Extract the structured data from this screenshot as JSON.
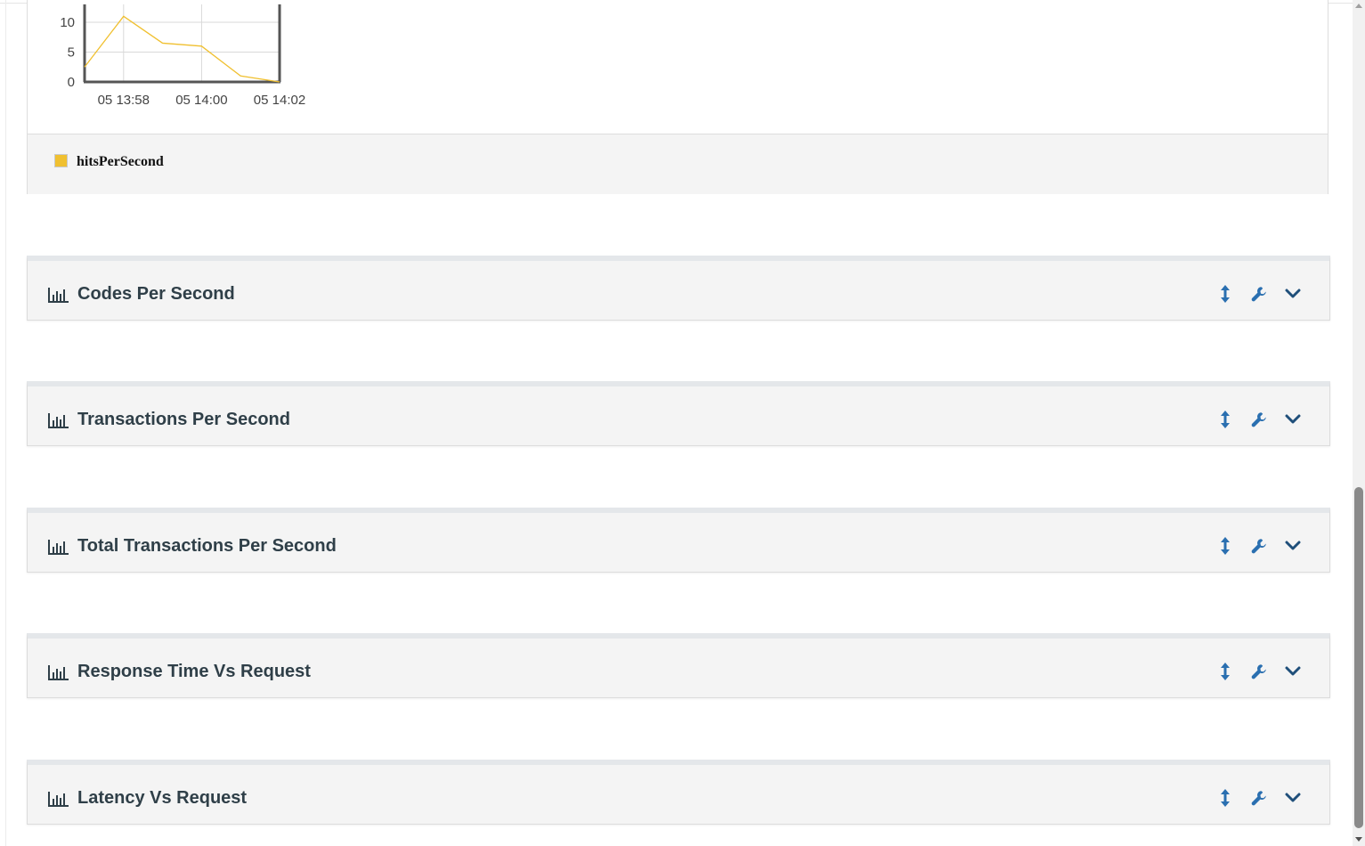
{
  "chart_data": {
    "type": "line",
    "x": [
      "05 13:57",
      "05 13:58",
      "05 13:59",
      "05 14:00",
      "05 14:01",
      "05 14:02"
    ],
    "x_tick_labels": [
      "05 13:58",
      "05 14:00",
      "05 14:02"
    ],
    "y_tick_labels": [
      "0",
      "5",
      "10"
    ],
    "series": [
      {
        "name": "hitsPerSecond",
        "values": [
          2.5,
          11,
          6.5,
          6,
          1,
          0
        ],
        "color": "#f0c030"
      }
    ],
    "ylim": [
      0,
      13
    ],
    "grid": true
  },
  "legend": {
    "label": "hitsPerSecond",
    "color": "#f0c030"
  },
  "widgets": [
    {
      "title": "Codes Per Second"
    },
    {
      "title": "Transactions Per Second"
    },
    {
      "title": "Total Transactions Per Second"
    },
    {
      "title": "Response Time Vs Request"
    },
    {
      "title": "Latency Vs Request"
    }
  ],
  "icons": {
    "chart": "bar-chart-icon",
    "resize": "vertical-resize-icon",
    "config": "wrench-icon",
    "collapse": "chevron-down-icon"
  },
  "colors": {
    "title": "#2f3f48",
    "action": "#2a6fb0",
    "series": "#f0c030"
  }
}
